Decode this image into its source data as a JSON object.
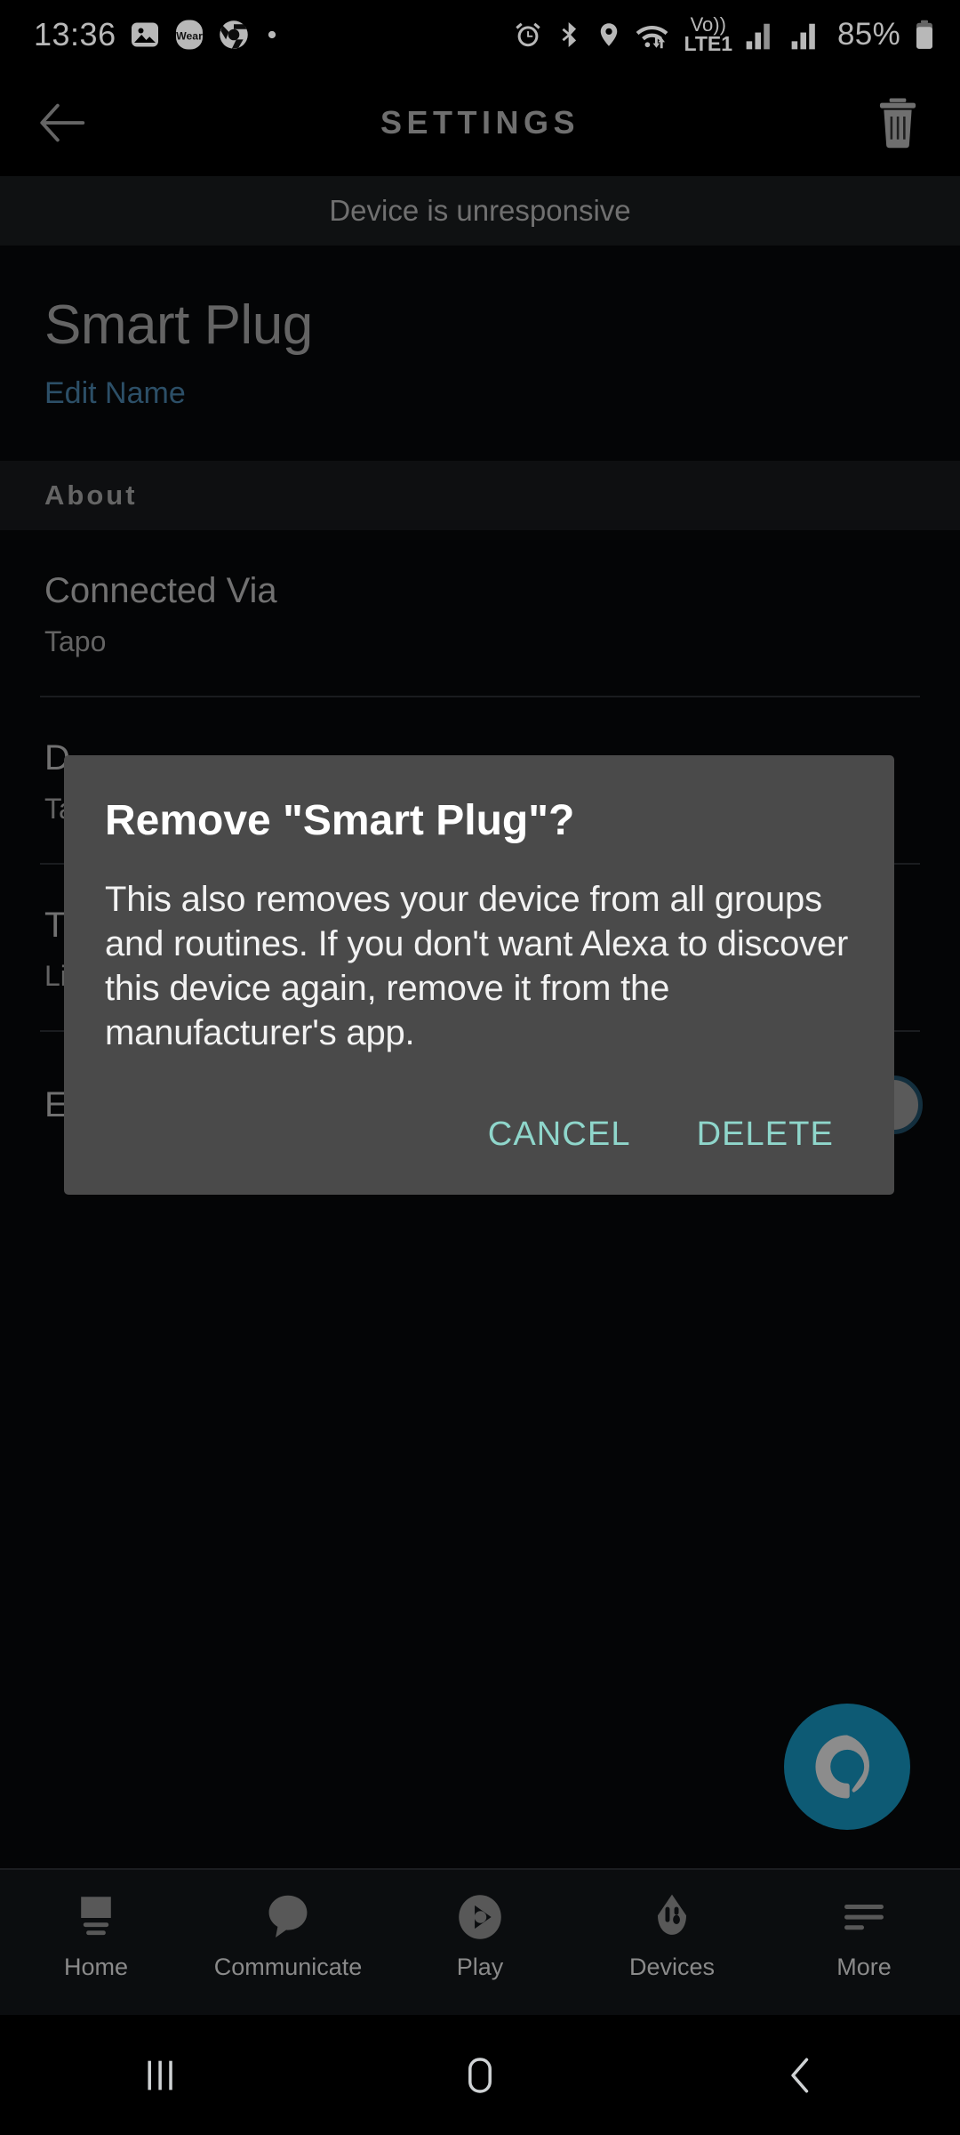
{
  "status_bar": {
    "time": "13:36",
    "battery_percent": "85%",
    "network_label": "Vo))",
    "network_label2": "LTE1",
    "notification_icons": [
      "gallery-icon",
      "wear-icon",
      "chrome-icon",
      "dot-icon"
    ],
    "system_icons": [
      "alarm-icon",
      "bluetooth-icon",
      "location-icon",
      "wifi-icon",
      "volte-icon",
      "signal-icon-1",
      "signal-icon-2",
      "battery-icon"
    ]
  },
  "app_bar": {
    "back_label": "back-arrow",
    "title": "SETTINGS",
    "delete_label": "trash"
  },
  "banner": {
    "text": "Device is unresponsive"
  },
  "device": {
    "name": "Smart Plug",
    "edit_name_link": "Edit Name"
  },
  "about": {
    "section_title": "About",
    "rows": [
      {
        "label": "Connected Via",
        "value": "Tapo",
        "has_toggle": false
      },
      {
        "label": "D",
        "value": "Ta",
        "has_toggle": false
      },
      {
        "label": "T",
        "value": "Li",
        "has_toggle": false
      },
      {
        "label": "E",
        "value": "",
        "has_toggle": true
      }
    ]
  },
  "dialog": {
    "title": "Remove \"Smart Plug\"?",
    "message": "This also removes your device from all groups and routines. If you don't want Alexa to discover this device again, remove it from the manufacturer's app.",
    "cancel_label": "CANCEL",
    "delete_label": "DELETE",
    "accent_color": "#8fd6cb",
    "background_color": "#4a4a4a"
  },
  "fab": {
    "name": "alexa-button"
  },
  "bottom_nav": {
    "items": [
      {
        "label": "Home",
        "icon": "home-icon"
      },
      {
        "label": "Communicate",
        "icon": "chat-bubble-icon"
      },
      {
        "label": "Play",
        "icon": "play-circle-icon"
      },
      {
        "label": "Devices",
        "icon": "devices-icon"
      },
      {
        "label": "More",
        "icon": "menu-lines-icon"
      }
    ]
  },
  "system_nav": {
    "recents": "recents-icon",
    "home": "home-square-icon",
    "back": "back-chevron-icon"
  }
}
